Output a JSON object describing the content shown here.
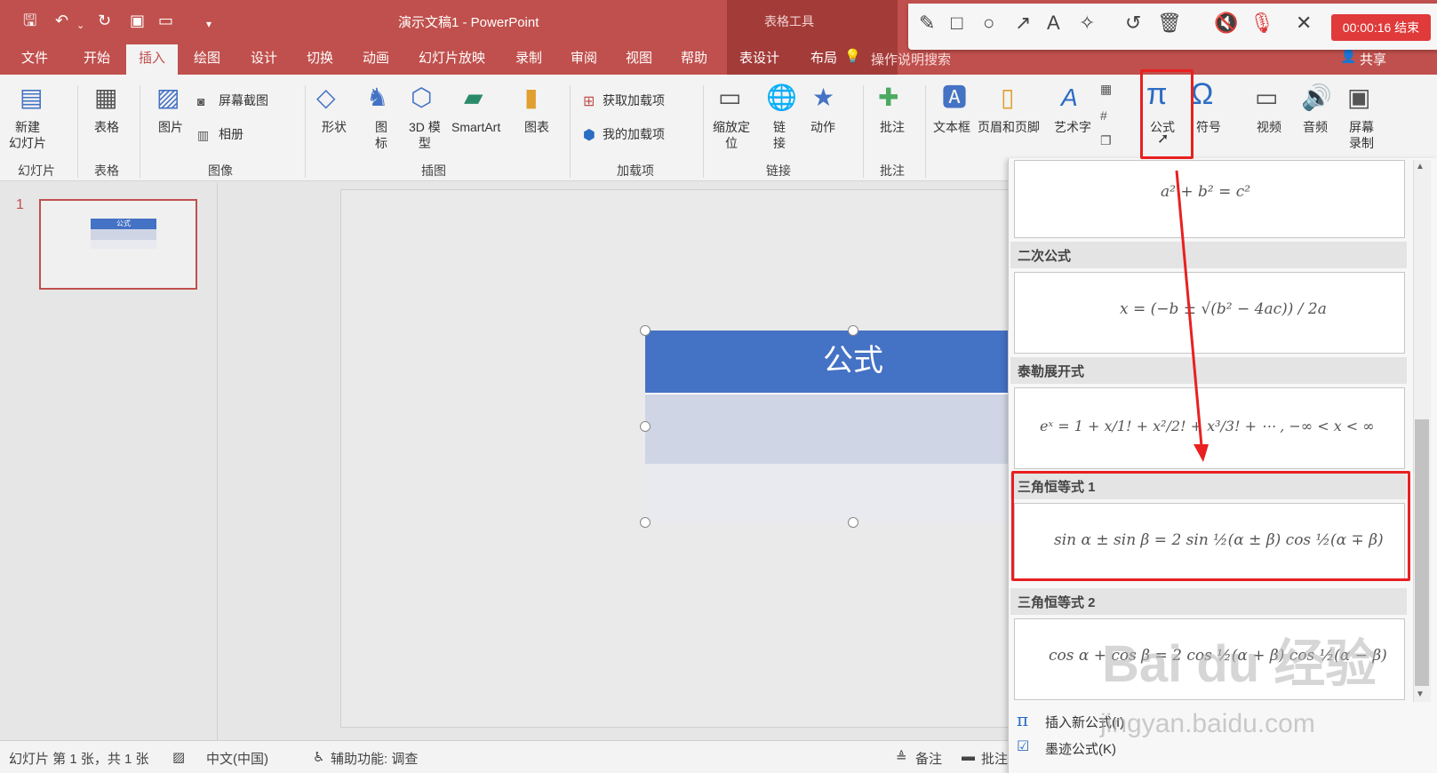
{
  "window": {
    "doc_title": "演示文稿1  -  PowerPoint",
    "context_tools": "表格工具"
  },
  "tabs": [
    "文件",
    "开始",
    "插入",
    "绘图",
    "设计",
    "切换",
    "动画",
    "幻灯片放映",
    "录制",
    "审阅",
    "视图",
    "帮助",
    "表设计",
    "布局"
  ],
  "active_tab": "插入",
  "tell_me": "操作说明搜索",
  "share": "共享",
  "rec_toolbar": {
    "timer": "00:00:16 结束"
  },
  "ribbon": {
    "new_slide": "新建\n幻灯片",
    "table": "表格",
    "picture": "图片",
    "screenshot": "屏幕截图",
    "album": "相册",
    "shapes": "形状",
    "icons": "图\n标",
    "model3d": "3D 模\n型",
    "smartart": "SmartArt",
    "chart": "图表",
    "get_addins": "获取加载项",
    "my_addins": "我的加载项",
    "zoom": "缩放定\n位",
    "link": "链\n接",
    "action": "动作",
    "comment": "批注",
    "textbox": "文本框",
    "header_footer": "页眉和页脚",
    "wordart": "艺术字",
    "equation": "公式",
    "symbol": "符号",
    "video": "视频",
    "audio": "音频",
    "screen_rec": "屏幕\n录制",
    "groups": {
      "slides": "幻灯片",
      "tables": "表格",
      "images": "图像",
      "illustrations": "插图",
      "addins": "加载项",
      "links": "链接",
      "comments": "批注"
    }
  },
  "slide": {
    "number": "1",
    "table_title": "公式",
    "thumb_title": "公式"
  },
  "gallery": {
    "items": [
      {
        "header": "",
        "formula": "a² + b² = c²"
      },
      {
        "header": "二次公式",
        "formula": "x = (−b ± √(b² − 4ac)) / 2a"
      },
      {
        "header": "泰勒展开式",
        "formula": "eˣ = 1 + x/1! + x²/2! + x³/3! + ⋯ ,    −∞ < x < ∞"
      },
      {
        "header": "三角恒等式 1",
        "formula": "sin α ± sin β = 2 sin ½(α ± β) cos ½(α ∓ β)"
      },
      {
        "header": "三角恒等式 2",
        "formula": "cos α + cos β = 2 cos ½(α + β) cos ½(α − β)"
      }
    ],
    "insert_new": "插入新公式(I)",
    "ink_equation": "墨迹公式(K)"
  },
  "status": {
    "slide_info": "幻灯片 第 1 张，共 1 张",
    "language": "中文(中国)",
    "accessibility": "辅助功能: 调查",
    "notes": "备注",
    "comments": "批注"
  },
  "watermark": {
    "brand": "Bai du 经验",
    "url": "jingyan.baidu.com"
  },
  "colors": {
    "accent": "#c0504d",
    "table_header": "#4472c4",
    "highlight": "#e82020"
  }
}
